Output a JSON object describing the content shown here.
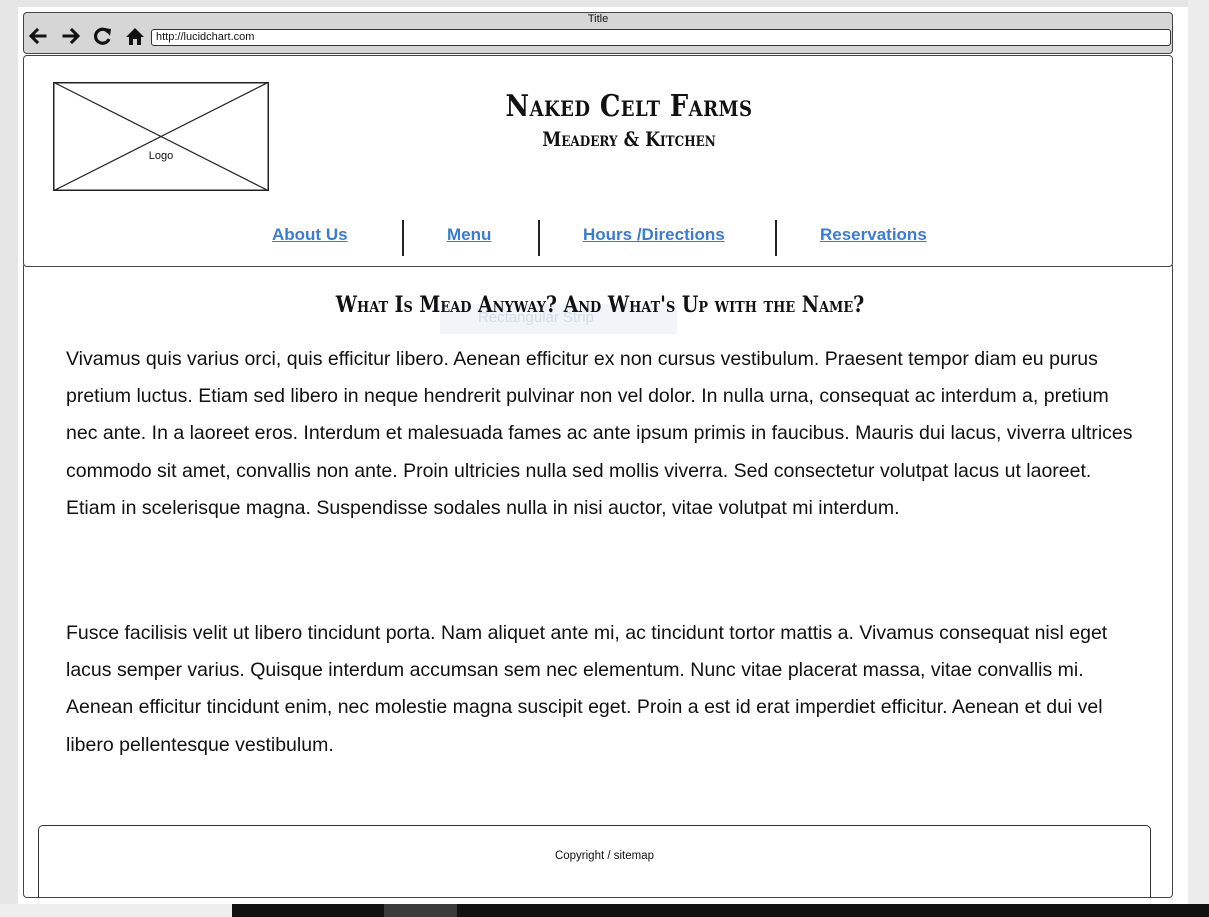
{
  "browser": {
    "title": "Title",
    "url": "http://lucidchart.com"
  },
  "header": {
    "logo_label": "Logo",
    "site_title": "Naked Celt Farms",
    "site_subtitle": "Meadery & Kitchen"
  },
  "nav": {
    "items": [
      {
        "label": "About Us"
      },
      {
        "label": "Menu"
      },
      {
        "label": "Hours /Directions"
      },
      {
        "label": "Reservations"
      }
    ]
  },
  "main": {
    "ghost_label": "Rectangular Strip",
    "heading": "What Is Mead Anyway? And What's Up with the Name?",
    "paragraphs": [
      "Vivamus quis varius orci, quis efficitur libero. Aenean efficitur ex non cursus vestibulum. Praesent tempor diam eu purus pretium luctus. Etiam sed libero in neque hendrerit pulvinar non vel dolor. In nulla urna, consequat ac interdum a, pretium nec ante. In a laoreet eros. Interdum et malesuada fames ac ante ipsum primis in faucibus. Mauris dui lacus, viverra ultrices commodo sit amet, convallis non ante. Proin ultricies nulla sed mollis viverra. Sed consectetur volutpat lacus ut laoreet. Etiam in scelerisque magna. Suspendisse sodales nulla in nisi auctor, vitae volutpat mi interdum.",
      "Fusce facilisis velit ut libero tincidunt porta. Nam aliquet ante mi, ac tincidunt tortor mattis a. Vivamus consequat nisl eget lacus semper varius. Quisque interdum accumsan sem nec elementum. Nunc vitae placerat massa, vitae convallis mi. Aenean efficitur tincidunt enim, nec molestie magna suscipit eget. Proin a est id erat imperdiet efficitur. Aenean et dui vel libero pellentesque vestibulum."
    ]
  },
  "footer": {
    "text": "Copyright / sitemap"
  },
  "colors": {
    "link": "#3a7bd5",
    "chrome": "#d6d6d6"
  },
  "icons": [
    "back-arrow-icon",
    "forward-arrow-icon",
    "refresh-icon",
    "home-icon"
  ]
}
